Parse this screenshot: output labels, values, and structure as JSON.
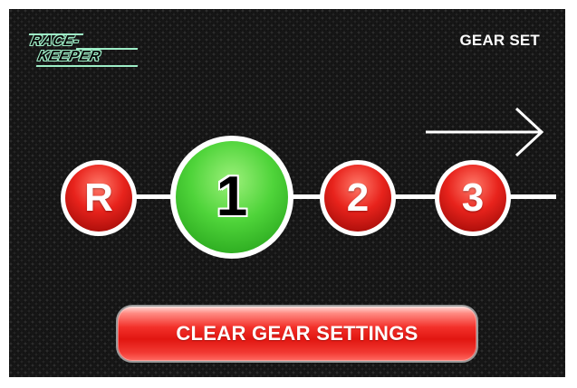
{
  "logo": {
    "line1": "RACE-",
    "line2": "KEEPER"
  },
  "header": {
    "title": "GEAR SET"
  },
  "direction_arrow": {
    "icon": "arrow-right-icon"
  },
  "gears": [
    {
      "label": "R",
      "state": "inactive",
      "color": "#e8231c"
    },
    {
      "label": "1",
      "state": "selected",
      "color": "#4fd43a"
    },
    {
      "label": "2",
      "state": "inactive",
      "color": "#e8231c"
    },
    {
      "label": "3",
      "state": "inactive",
      "color": "#e8231c"
    }
  ],
  "clear_button": {
    "label": "CLEAR GEAR SETTINGS",
    "color": "#e11611"
  }
}
